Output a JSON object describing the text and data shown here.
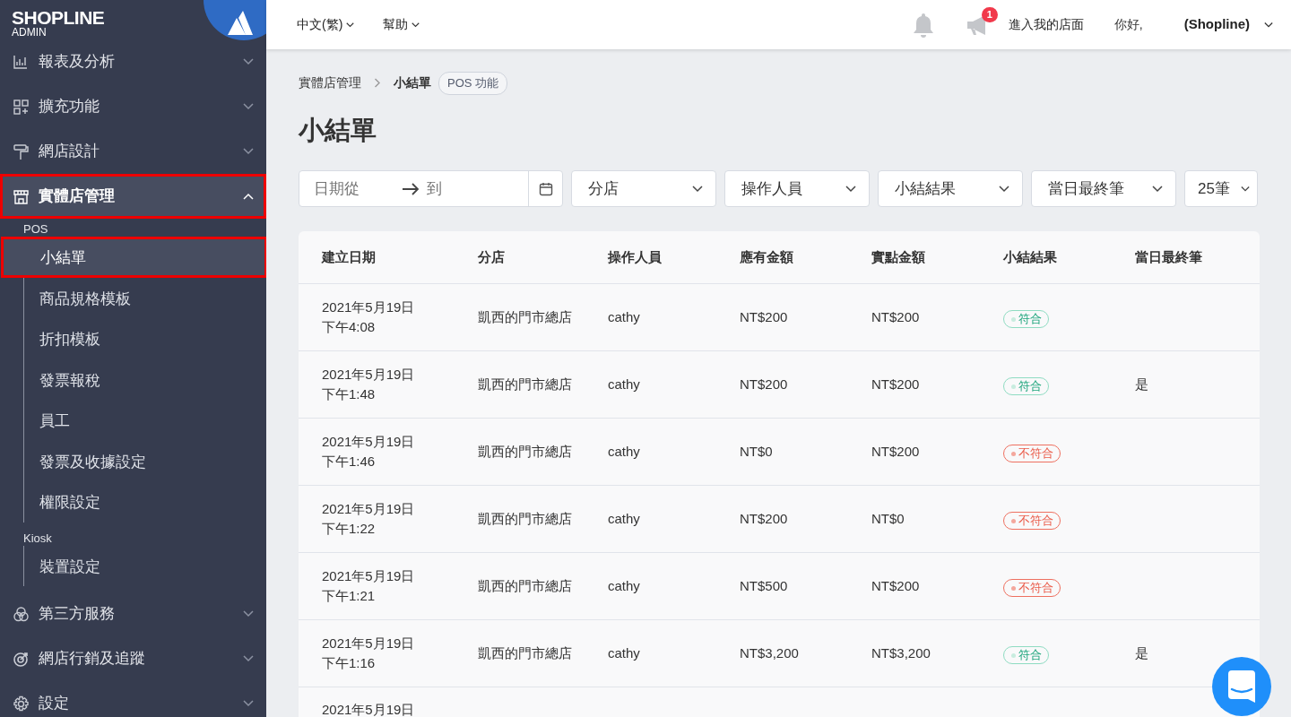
{
  "logo": {
    "brand": "SHOPLINE",
    "sub": "ADMIN"
  },
  "topbar": {
    "menus": [
      {
        "label": "中文(繁)"
      },
      {
        "label": "幫助"
      }
    ],
    "notification_count": "1",
    "store_link": "進入我的店面",
    "greeting": "你好,",
    "user": "(Shopline)"
  },
  "sidebar": {
    "items": [
      {
        "label": "報表及分析",
        "expanded": false,
        "highlighted": false
      },
      {
        "label": "擴充功能",
        "expanded": false,
        "highlighted": false
      },
      {
        "label": "網店設計",
        "expanded": false,
        "highlighted": false
      },
      {
        "label": "實體店管理",
        "expanded": true,
        "highlighted": true,
        "groups": [
          {
            "title": "POS",
            "children": [
              {
                "label": "小結單",
                "selected": true,
                "highlighted": true
              },
              {
                "label": "商品規格模板",
                "selected": false,
                "highlighted": false
              },
              {
                "label": "折扣模板",
                "selected": false,
                "highlighted": false
              },
              {
                "label": "發票報稅",
                "selected": false,
                "highlighted": false
              },
              {
                "label": "員工",
                "selected": false,
                "highlighted": false
              },
              {
                "label": "發票及收據設定",
                "selected": false,
                "highlighted": false
              },
              {
                "label": "權限設定",
                "selected": false,
                "highlighted": false
              }
            ]
          },
          {
            "title": "Kiosk",
            "children": [
              {
                "label": "裝置設定",
                "selected": false,
                "highlighted": false
              }
            ]
          }
        ]
      },
      {
        "label": "第三方服務",
        "expanded": false,
        "highlighted": false
      },
      {
        "label": "網店行銷及追蹤",
        "expanded": false,
        "highlighted": false
      },
      {
        "label": "設定",
        "expanded": false,
        "highlighted": false
      }
    ]
  },
  "breadcrumb": {
    "parent": "實體店管理",
    "current": "小結單",
    "tag": "POS 功能"
  },
  "title": "小結單",
  "filters": {
    "date_from_placeholder": "日期從",
    "date_to_placeholder": "到",
    "selects": [
      {
        "label": "分店"
      },
      {
        "label": "操作人員"
      },
      {
        "label": "小結結果"
      },
      {
        "label": "當日最終筆"
      }
    ],
    "per_page": "25筆"
  },
  "table": {
    "columns": [
      "建立日期",
      "分店",
      "操作人員",
      "應有金額",
      "實點金額",
      "小結結果",
      "當日最終筆"
    ],
    "rows": [
      {
        "date": "2021年5月19日",
        "time": "下午4:08",
        "store": "凱西的門市總店",
        "operator": "cathy",
        "expected": "NT$200",
        "counted": "NT$200",
        "result": {
          "kind": "match",
          "label": "符合"
        },
        "final": ""
      },
      {
        "date": "2021年5月19日",
        "time": "下午1:48",
        "store": "凱西的門市總店",
        "operator": "cathy",
        "expected": "NT$200",
        "counted": "NT$200",
        "result": {
          "kind": "match",
          "label": "符合"
        },
        "final": "是"
      },
      {
        "date": "2021年5月19日",
        "time": "下午1:46",
        "store": "凱西的門市總店",
        "operator": "cathy",
        "expected": "NT$0",
        "counted": "NT$200",
        "result": {
          "kind": "mismatch",
          "label": "不符合"
        },
        "final": ""
      },
      {
        "date": "2021年5月19日",
        "time": "下午1:22",
        "store": "凱西的門市總店",
        "operator": "cathy",
        "expected": "NT$200",
        "counted": "NT$0",
        "result": {
          "kind": "mismatch",
          "label": "不符合"
        },
        "final": ""
      },
      {
        "date": "2021年5月19日",
        "time": "下午1:21",
        "store": "凱西的門市總店",
        "operator": "cathy",
        "expected": "NT$500",
        "counted": "NT$200",
        "result": {
          "kind": "mismatch",
          "label": "不符合"
        },
        "final": ""
      },
      {
        "date": "2021年5月19日",
        "time": "下午1:16",
        "store": "凱西的門市總店",
        "operator": "cathy",
        "expected": "NT$3,200",
        "counted": "NT$3,200",
        "result": {
          "kind": "match",
          "label": "符合"
        },
        "final": "是"
      },
      {
        "date": "2021年5月19日"
      }
    ]
  }
}
